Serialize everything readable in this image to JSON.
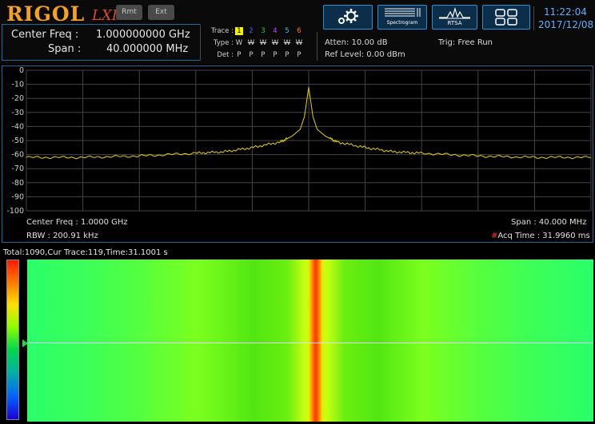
{
  "header": {
    "logo": "RIGOL",
    "lxi": "LXI",
    "rmt_label": "Rmt",
    "ext_label": "Ext",
    "center_freq_label": "Center Freq :",
    "center_freq_value": "1.000000000 GHz",
    "span_label": "Span :",
    "span_value": "40.000000 MHz",
    "trace_label": "Trace :",
    "type_label": "Type :",
    "det_label": "Det :",
    "traces": [
      {
        "num": "1",
        "type": "W",
        "det": "P",
        "color": "#f0f000",
        "active": true
      },
      {
        "num": "2",
        "type": "W",
        "det": "P",
        "color": "#2e6bff",
        "active": false
      },
      {
        "num": "3",
        "type": "W",
        "det": "P",
        "color": "#1fd01f",
        "active": false
      },
      {
        "num": "4",
        "type": "W",
        "det": "P",
        "color": "#d040ff",
        "active": false
      },
      {
        "num": "5",
        "type": "W",
        "det": "P",
        "color": "#30c8ff",
        "active": false
      },
      {
        "num": "6",
        "type": "W",
        "det": "P",
        "color": "#ff7a1a",
        "active": false
      }
    ],
    "atten": "Atten: 10.00 dB",
    "ref_level": "Ref Level: 0.00 dBm",
    "trig": "Trig: Free Run",
    "buttons": [
      {
        "icon": "settings-gears-icon",
        "label": ""
      },
      {
        "icon": "spectrogram-icon",
        "label": "Spectrogram"
      },
      {
        "icon": "rtsa-icon",
        "label": "RTSA"
      },
      {
        "icon": "window-layout-icon",
        "label": ""
      }
    ],
    "time": "11:22:04",
    "date": "2017/12/08"
  },
  "spectrum": {
    "y_ticks": [
      "0",
      "-10",
      "-20",
      "-30",
      "-40",
      "-50",
      "-60",
      "-70",
      "-80",
      "-90",
      "-100"
    ],
    "center_freq": "Center Freq : 1.0000 GHz",
    "span": "Span : 40.000 MHz",
    "rbw": "RBW : 200.91 kHz",
    "acq_marker": "#",
    "acq_time": "Acq Time : 31.9960 ms",
    "trace_color": "#e8d200",
    "chart_data": {
      "type": "line",
      "ylim": [
        -100,
        0
      ],
      "xlim": [
        -20,
        20
      ],
      "x_unit": "MHz offset",
      "y_unit": "dBm",
      "grid": true,
      "x": [
        -20,
        -16,
        -12,
        -8,
        -6,
        -4,
        -2,
        -1.2,
        -0.6,
        -0.3,
        0,
        0.3,
        0.6,
        1.2,
        2,
        4,
        6,
        8,
        12,
        16,
        20
      ],
      "y": [
        -62,
        -62,
        -61,
        -59,
        -58,
        -55,
        -51,
        -47,
        -42,
        -33,
        -12,
        -33,
        -42,
        -47,
        -51,
        -55,
        -58,
        -59,
        -61,
        -62,
        -62
      ]
    }
  },
  "waterfall": {
    "info": "Total:1090,Cur Trace:119,Time:31.1001 s"
  }
}
